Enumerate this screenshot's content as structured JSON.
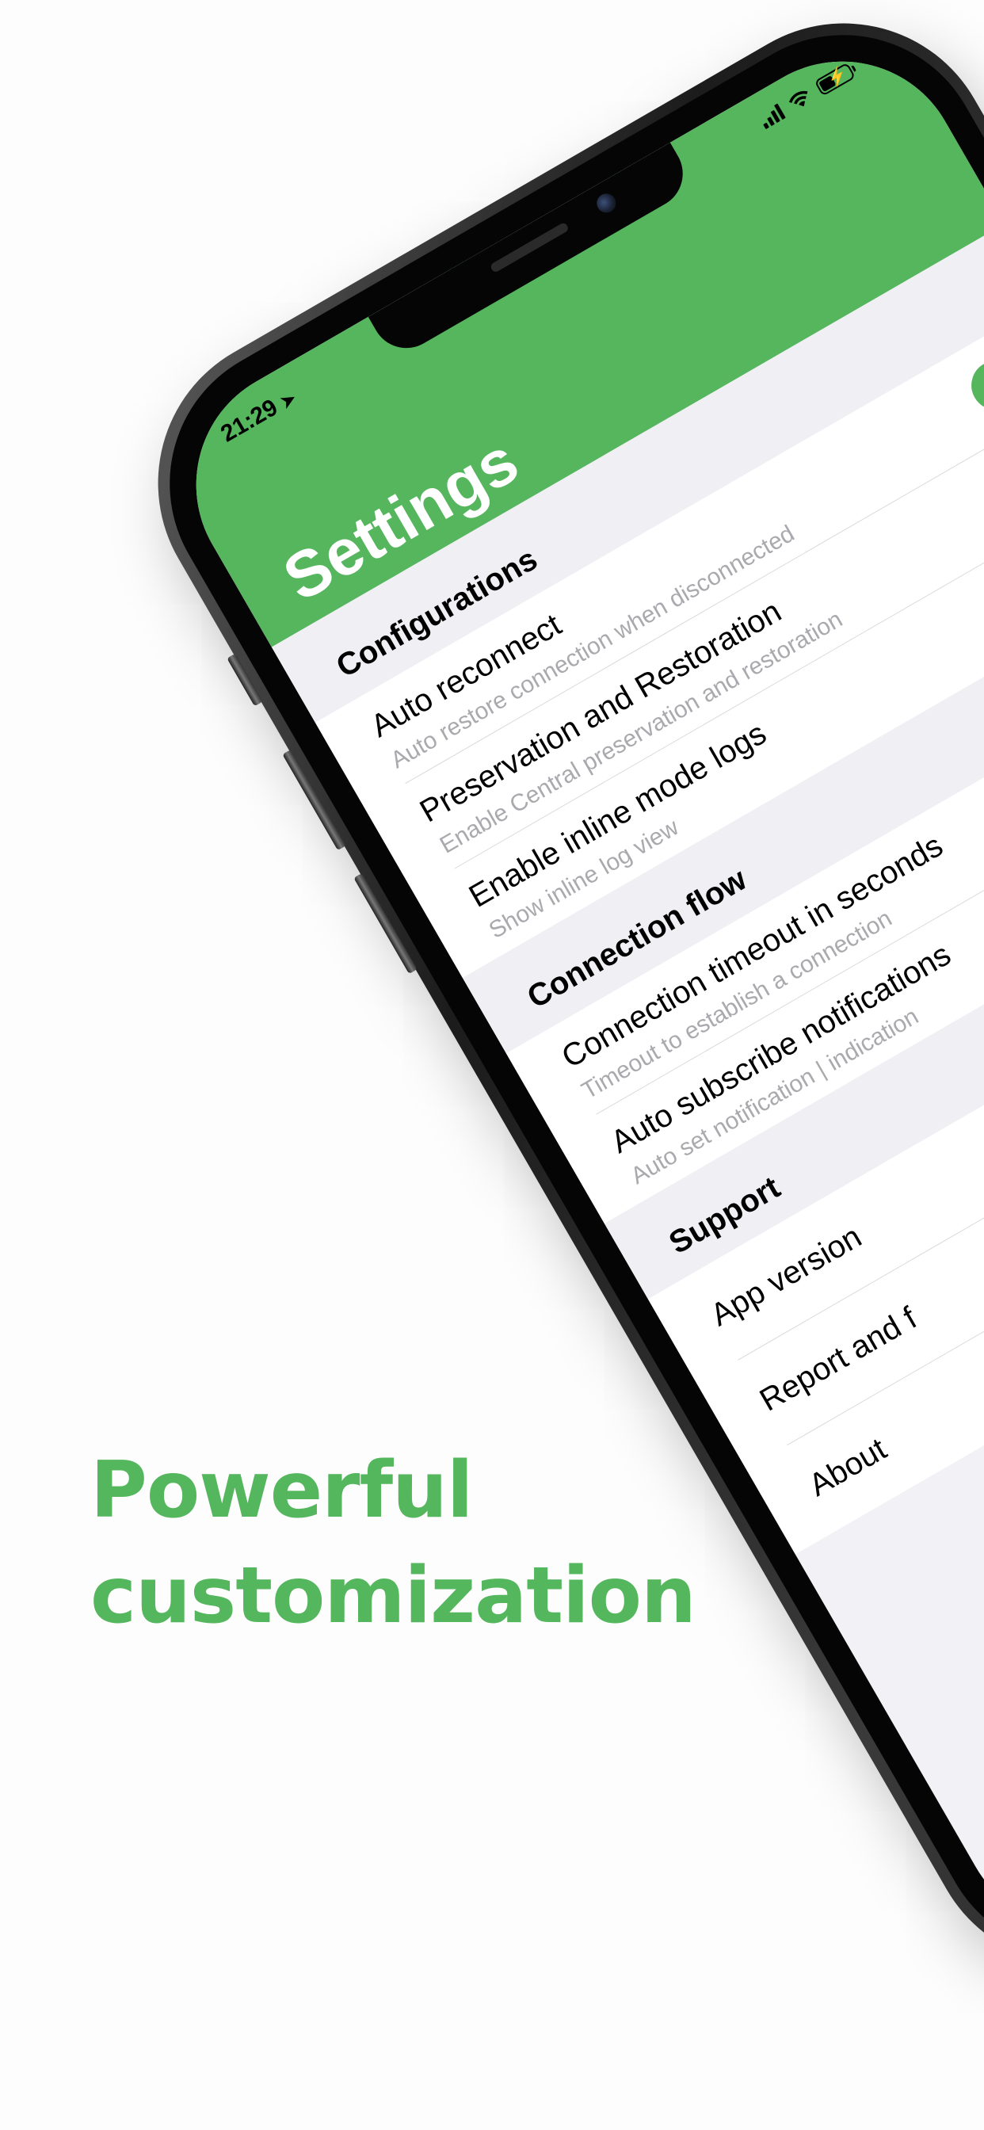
{
  "headline": {
    "line1": "Powerful",
    "line2": "customization"
  },
  "status_bar": {
    "time": "21:29",
    "location_icon": "location-arrow-icon",
    "signal_icon": "cellular-signal-icon",
    "wifi_icon": "wifi-icon",
    "battery_icon": "battery-charging-icon",
    "bolt_glyph": "⚡"
  },
  "nav": {
    "title": "Settings"
  },
  "sections": {
    "configurations": {
      "title": "Configurations",
      "auto_reconnect": {
        "title": "Auto reconnect",
        "subtitle": "Auto restore connection when disconnected",
        "toggle": true
      },
      "preservation": {
        "title": "Preservation and Restoration",
        "subtitle": "Enable Central preservation and restoration",
        "toggle": false
      },
      "inline_logs": {
        "title": "Enable inline mode logs",
        "subtitle": "Show inline log view"
      }
    },
    "connection_flow": {
      "title": "Connection flow",
      "timeout": {
        "title": "Connection timeout in seconds",
        "subtitle": "Timeout to establish a connection"
      },
      "auto_subscribe": {
        "title": "Auto subscribe notifications",
        "subtitle": "Auto set notification | indication"
      }
    },
    "support": {
      "title": "Support",
      "app_version": {
        "title": "App version"
      },
      "report": {
        "title": "Report and f"
      },
      "about": {
        "title": "About"
      }
    }
  },
  "colors": {
    "accent": "#55b65d",
    "background": "#fdfdfd",
    "section_background": "#efeff4",
    "subtitle": "#a9a9ae"
  }
}
